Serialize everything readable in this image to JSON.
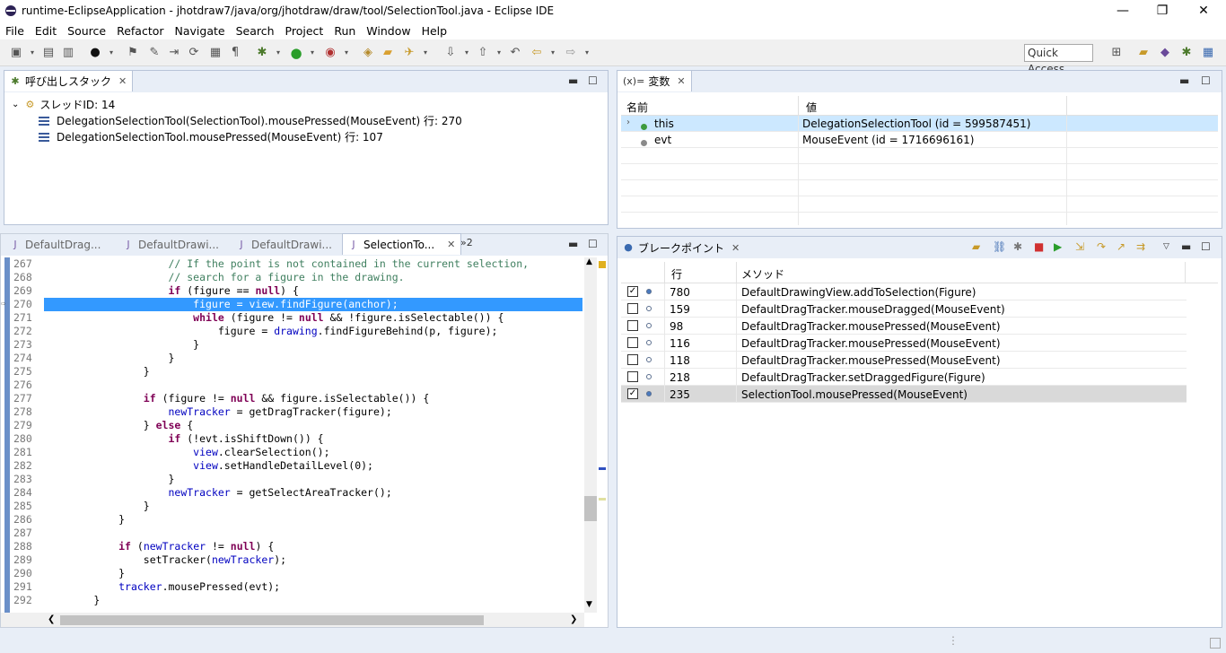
{
  "window": {
    "title": "runtime-EclipseApplication - jhotdraw7/java/org/jhotdraw/draw/tool/SelectionTool.java - Eclipse IDE",
    "minimize": "—",
    "maximize": "❐",
    "close": "✕"
  },
  "menu": [
    "File",
    "Edit",
    "Source",
    "Refactor",
    "Navigate",
    "Search",
    "Project",
    "Run",
    "Window",
    "Help"
  ],
  "toolbar": {
    "quick_access": "Quick Access"
  },
  "callstack": {
    "tab_label": "呼び出しスタック",
    "thread": "スレッドID: 14",
    "frames": [
      "DelegationSelectionTool(SelectionTool).mousePressed(MouseEvent) 行: 270",
      "DelegationSelectionTool.mousePressed(MouseEvent) 行: 107"
    ]
  },
  "variables": {
    "tab_label": "変数",
    "tab_prefix": "(x)=",
    "col_name": "名前",
    "col_value": "値",
    "rows": [
      {
        "name": "this",
        "value": "DelegationSelectionTool (id = 599587451)"
      },
      {
        "name": "evt",
        "value": "MouseEvent (id = 1716696161)"
      }
    ]
  },
  "editor": {
    "tabs": [
      "DefaultDrag...",
      "DefaultDrawi...",
      "DefaultDrawi...",
      "SelectionTo..."
    ],
    "overflow": "»2",
    "lines": [
      {
        "n": "267",
        "html": "<span class=\"cm\">// If the point is not contained in the current selection,</span>",
        "indent": 5
      },
      {
        "n": "268",
        "html": "<span class=\"cm\">// search for a figure in the drawing.</span>",
        "indent": 5
      },
      {
        "n": "269",
        "html": "<span class=\"kw\">if</span> (figure == <span class=\"kw\">null</span>) {",
        "indent": 5
      },
      {
        "n": "270",
        "html": "figure = view.findFigure(anchor);",
        "indent": 6,
        "hl": true
      },
      {
        "n": "271",
        "html": "<span class=\"kw\">while</span> (figure != <span class=\"kw\">null</span> &amp;&amp; !figure.isSelectable()) {",
        "indent": 6
      },
      {
        "n": "272",
        "html": "figure = <span class=\"fd\">drawing</span>.findFigureBehind(p, figure);",
        "indent": 7
      },
      {
        "n": "273",
        "html": "}",
        "indent": 6
      },
      {
        "n": "274",
        "html": "}",
        "indent": 5
      },
      {
        "n": "275",
        "html": "}",
        "indent": 4
      },
      {
        "n": "276",
        "html": "",
        "indent": 0
      },
      {
        "n": "277",
        "html": "<span class=\"kw\">if</span> (figure != <span class=\"kw\">null</span> &amp;&amp; figure.isSelectable()) {",
        "indent": 4
      },
      {
        "n": "278",
        "html": "<span class=\"fd\">newTracker</span> = getDragTracker(figure);",
        "indent": 5
      },
      {
        "n": "279",
        "html": "} <span class=\"kw\">else</span> {",
        "indent": 4
      },
      {
        "n": "280",
        "html": "<span class=\"kw\">if</span> (!evt.isShiftDown()) {",
        "indent": 5
      },
      {
        "n": "281",
        "html": "<span class=\"fd\">view</span>.clearSelection();",
        "indent": 6
      },
      {
        "n": "282",
        "html": "<span class=\"fd\">view</span>.setHandleDetailLevel(0);",
        "indent": 6
      },
      {
        "n": "283",
        "html": "}",
        "indent": 5
      },
      {
        "n": "284",
        "html": "<span class=\"fd\">newTracker</span> = getSelectAreaTracker();",
        "indent": 5
      },
      {
        "n": "285",
        "html": "}",
        "indent": 4
      },
      {
        "n": "286",
        "html": "}",
        "indent": 3
      },
      {
        "n": "287",
        "html": "",
        "indent": 0
      },
      {
        "n": "288",
        "html": "<span class=\"kw\">if</span> (<span class=\"fd\">newTracker</span> != <span class=\"kw\">null</span>) {",
        "indent": 3
      },
      {
        "n": "289",
        "html": "setTracker(<span class=\"fd\">newTracker</span>);",
        "indent": 4
      },
      {
        "n": "290",
        "html": "}",
        "indent": 3
      },
      {
        "n": "291",
        "html": "<span class=\"fd\">tracker</span>.mousePressed(evt);",
        "indent": 3
      },
      {
        "n": "292",
        "html": "}",
        "indent": 2
      }
    ]
  },
  "breakpoints": {
    "tab_label": "ブレークポイント",
    "col_line": "行",
    "col_method": "メソッド",
    "rows": [
      {
        "checked": true,
        "line": "780",
        "method": "DefaultDrawingView.addToSelection(Figure)"
      },
      {
        "checked": false,
        "line": "159",
        "method": "DefaultDragTracker.mouseDragged(MouseEvent)"
      },
      {
        "checked": false,
        "line": "98",
        "method": "DefaultDragTracker.mousePressed(MouseEvent)"
      },
      {
        "checked": false,
        "line": "116",
        "method": "DefaultDragTracker.mousePressed(MouseEvent)"
      },
      {
        "checked": false,
        "line": "118",
        "method": "DefaultDragTracker.mousePressed(MouseEvent)"
      },
      {
        "checked": false,
        "line": "218",
        "method": "DefaultDragTracker.setDraggedFigure(Figure)"
      },
      {
        "checked": true,
        "line": "235",
        "method": "SelectionTool.mousePressed(MouseEvent)"
      }
    ]
  }
}
